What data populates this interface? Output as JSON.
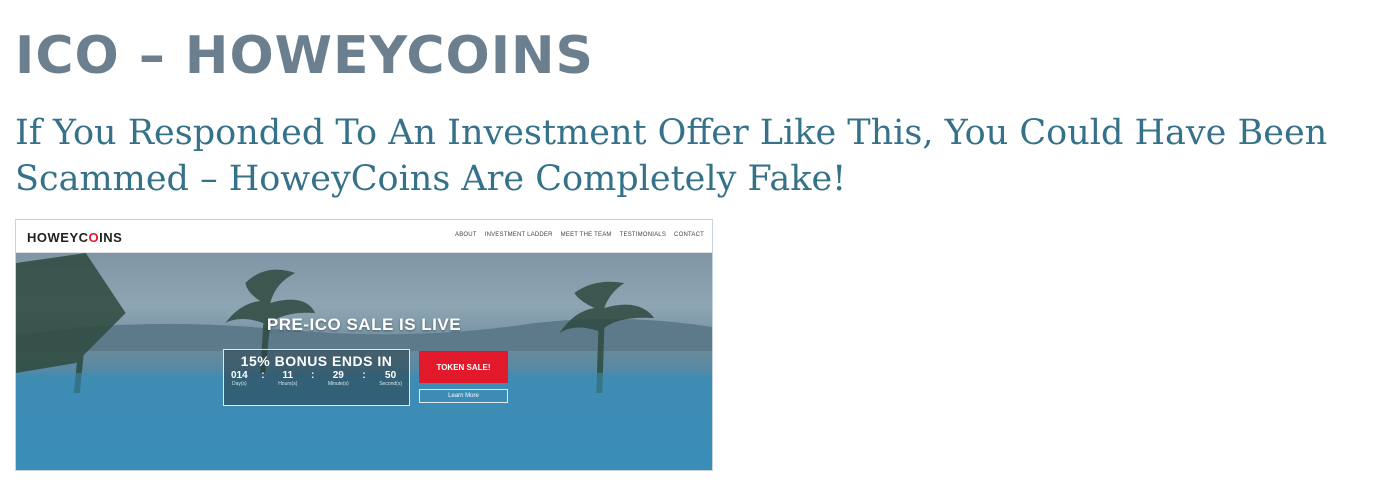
{
  "page": {
    "title": "ICO – HOWEYCOINS",
    "subtitle": "If You Responded To An Investment Offer Like This, You Could Have Been Scammed – HoweyCoins Are Completely Fake!"
  },
  "screenshot": {
    "logo_left": "HOWEYC",
    "logo_mark": "O",
    "logo_right": "INS",
    "nav": [
      "ABOUT",
      "INVESTMENT LADDER",
      "MEET THE TEAM",
      "TESTIMONIALS",
      "CONTACT"
    ],
    "headline": "PRE-ICO SALE IS LIVE",
    "bonus": "15% BONUS ENDS IN",
    "timer": [
      {
        "value": "014",
        "label": "Day(s)"
      },
      {
        "value": "11",
        "label": "Hours(s)"
      },
      {
        "value": "29",
        "label": "Minute(s)"
      },
      {
        "value": "50",
        "label": "Second(s)"
      }
    ],
    "separator": ":",
    "token_button": "TOKEN SALE!",
    "learn_button": "Learn More"
  },
  "colors": {
    "title": "#6b7f8e",
    "subtitle": "#35728a",
    "token_button": "#e2192a"
  }
}
